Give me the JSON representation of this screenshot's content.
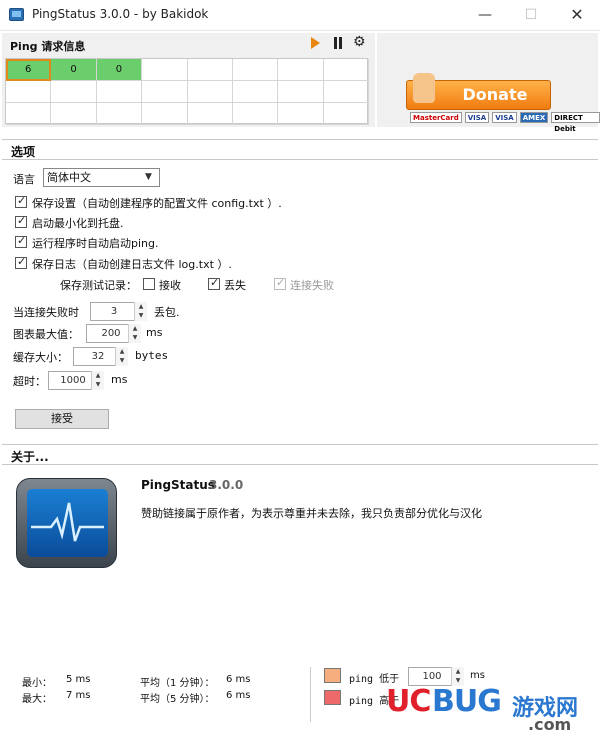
{
  "window": {
    "title": "PingStatus 3.0.0 - by Bakidok",
    "min_glyph": "—",
    "max_glyph": "☐",
    "close_glyph": "✕"
  },
  "ping": {
    "header": "Ping 请求信息",
    "cells": [
      "6",
      "0",
      "0",
      "",
      "",
      "",
      "",
      "",
      "",
      "",
      "",
      "",
      "",
      "",
      "",
      "",
      "",
      "",
      "",
      "",
      "",
      "",
      "",
      ""
    ],
    "ok_color": "#6ccd6c",
    "selected_color": "#e08a1e"
  },
  "donate": {
    "label": "Donate",
    "cards": [
      "MasterCard",
      "VISA",
      "VISA",
      "AMEX",
      "DIRECT Debit"
    ]
  },
  "options": {
    "title": "选项",
    "language_label": "语言",
    "language_value": "简体中文",
    "save_settings": "保存设置（自动创建程序的配置文件 config.txt ）.",
    "minimize_tray": "启动最小化到托盘.",
    "auto_start_ping": "运行程序时自动启动ping.",
    "save_log": "保存日志（自动创建日志文件 log.txt ）.",
    "save_records_label": "保存测试记录：",
    "record_received": "接收",
    "record_lost": "丢失",
    "record_conn_fail": "连接失败",
    "fail_when_label": "当连接失败时",
    "fail_when_value": "3",
    "fail_when_unit": "丢包.",
    "chart_max_label": "图表最大值：",
    "chart_max_value": "200",
    "chart_max_unit": "ms",
    "buffer_label": "缓存大小：",
    "buffer_value": "32",
    "buffer_unit": "bytes",
    "timeout_label": "超时：",
    "timeout_value": "1000",
    "timeout_unit": "ms",
    "accept_label": "接受"
  },
  "about": {
    "title": "关于...",
    "app_name": "PingStatus",
    "version": "3.0.0",
    "description": "赞助链接属于原作者，为表示尊重并未去除，我只负责部分优化与汉化"
  },
  "stats": {
    "min_label": "最小：",
    "min_value": "5 ms",
    "max_label": "最大：",
    "max_value": "7 ms",
    "avg1_label": "平均（1 分钟）：",
    "avg1_value": "6 ms",
    "avg5_label": "平均（5 分钟）：",
    "avg5_value": "6 ms",
    "low_label": "ping 低于",
    "low_value": "100",
    "low_unit": "ms",
    "high_label": "ping 高于",
    "low_color": "#f6ae7e",
    "high_color": "#ee6a6a"
  },
  "watermark": {
    "uc": "UC",
    "bug": "BUG",
    "cn": "游戏网",
    "com": ".com"
  }
}
